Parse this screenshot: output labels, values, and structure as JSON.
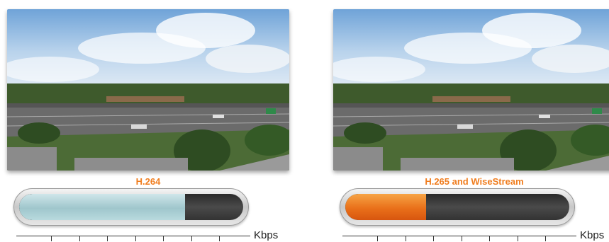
{
  "left": {
    "label": "H.264",
    "label_color": "#f07d1e",
    "bitrate_fraction": 0.74,
    "unit": "Kbps"
  },
  "right": {
    "label": "H.265 and WiseStream",
    "label_color": "#f07d1e",
    "bitrate_fraction": 0.36,
    "unit": "Kbps"
  },
  "axis_ticks": 7
}
